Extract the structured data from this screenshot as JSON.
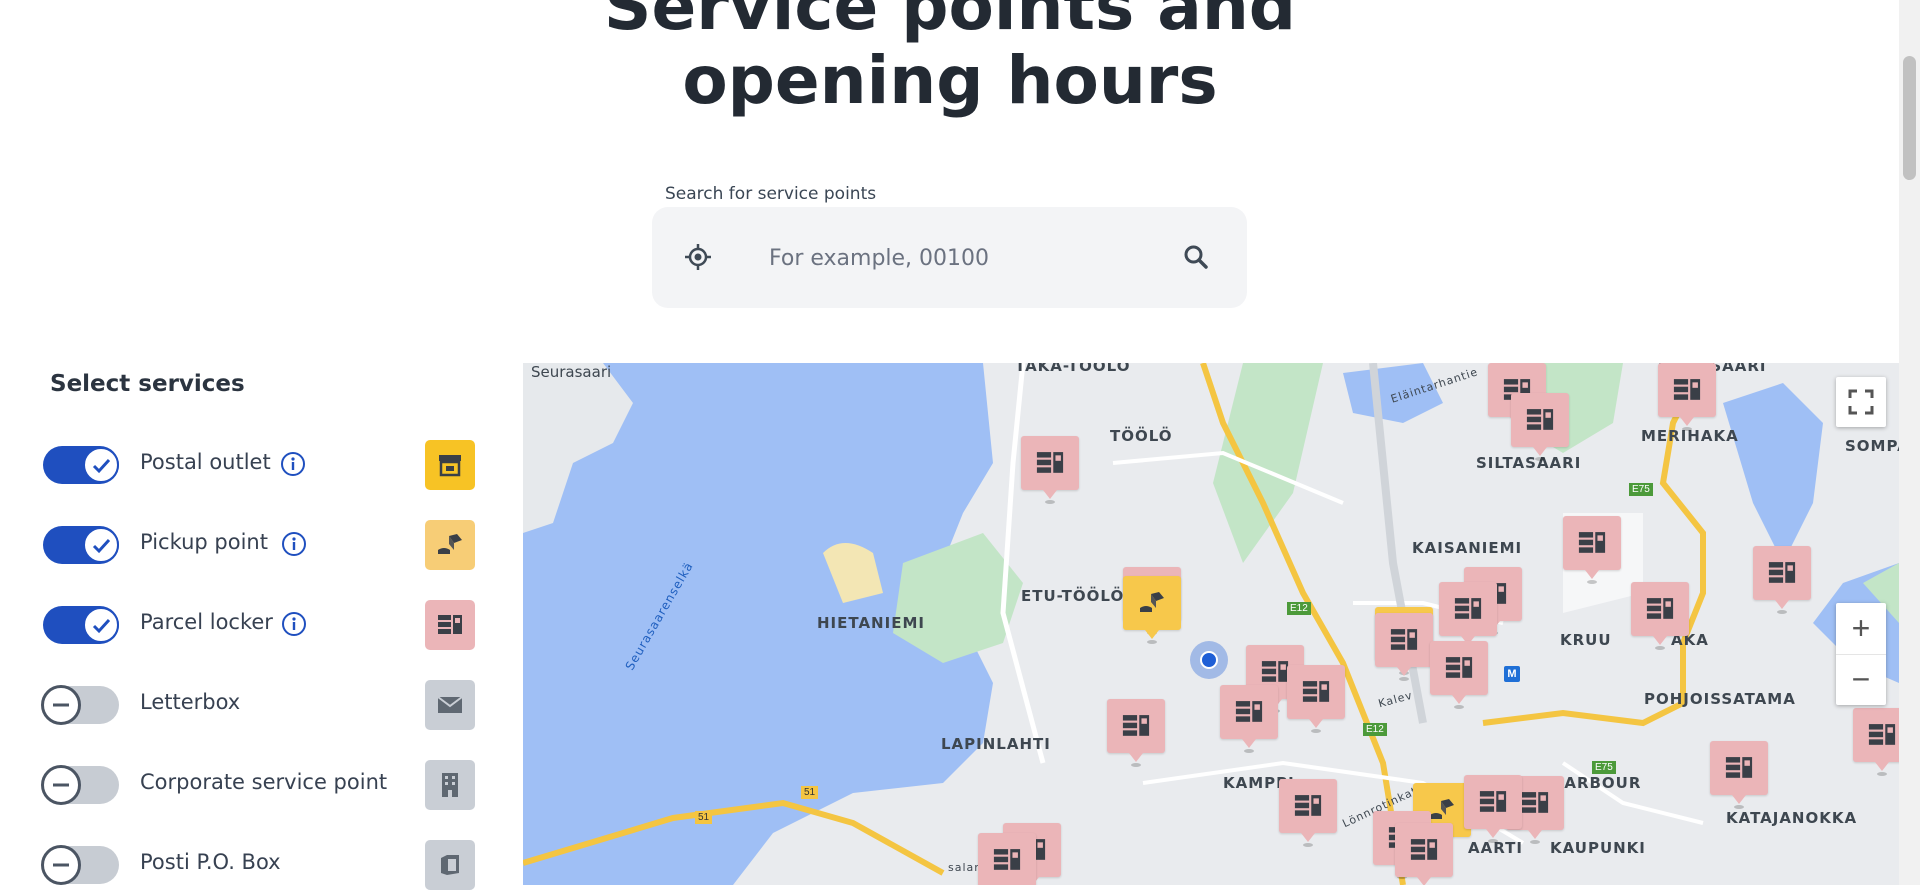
{
  "header": {
    "title_line1": "Service points and",
    "title_line2": "opening hours"
  },
  "search": {
    "label": "Search for service points",
    "placeholder": "For example, 00100"
  },
  "services": {
    "title": "Select services",
    "items": [
      {
        "label": "Postal outlet",
        "enabled": true,
        "info": true,
        "icon": "store-icon",
        "color": "#f7c325"
      },
      {
        "label": "Pickup point",
        "enabled": true,
        "info": true,
        "icon": "parcel-handover-icon",
        "color": "#f7cd76"
      },
      {
        "label": "Parcel locker",
        "enabled": true,
        "info": true,
        "icon": "parcel-locker-icon",
        "color": "#ebb5b8"
      },
      {
        "label": "Letterbox",
        "enabled": false,
        "info": false,
        "icon": "mail-icon",
        "color": "#c9ced5"
      },
      {
        "label": "Corporate service point",
        "enabled": false,
        "info": false,
        "icon": "building-icon",
        "color": "#c9ced5"
      },
      {
        "label": "Posti P.O. Box",
        "enabled": false,
        "info": false,
        "icon": "po-box-icon",
        "color": "#c9ced5"
      }
    ]
  },
  "map": {
    "labels": [
      "Seurasaari",
      "TAKA-TÖÖLÖ",
      "TÖÖLÖ",
      "HANASAARI",
      "MERIHAKA",
      "SOMPA",
      "SILTASAARI",
      "KAISANIEMI",
      "ETU-TÖÖLÖ",
      "HIETANIEMI",
      "KRUU",
      "AKA",
      "LAPINLAHTI",
      "KAMPPI",
      "POHJOISSATAMA",
      "H HARBOUR",
      "KATAJANOKKA",
      "AARTI",
      "KAUPUNKI",
      "Seurasaarenselkä",
      "Eläintarhantie",
      "Lönnrotinkatu",
      "salankatu",
      "Kalev"
    ],
    "road_shields": [
      "E12",
      "E12",
      "E75",
      "E75",
      "51",
      "51"
    ],
    "controls": {
      "fullscreen": "fullscreen-icon",
      "zoom_in": "+",
      "zoom_out": "−"
    },
    "colors": {
      "water": "#9fbff5",
      "land": "#e9ebee",
      "park": "#c3e5c7",
      "road_major": "#f4c542",
      "locker_marker": "#ebb5b8",
      "pickup_marker": "#f7c84b"
    }
  }
}
